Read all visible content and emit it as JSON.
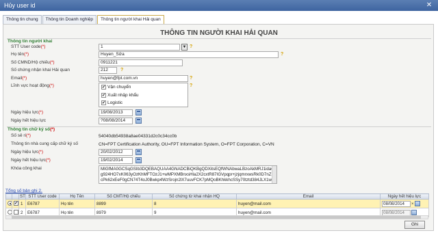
{
  "window": {
    "title": "Hủy user id",
    "close_glyph": "✕"
  },
  "tabs": [
    {
      "label": "Thông tin chung",
      "active": false
    },
    {
      "label": "Thông tin Doanh nghiệp",
      "active": false
    },
    {
      "label": "Thông tin người khai Hải quan",
      "active": true
    }
  ],
  "main_title": "THÔNG TIN NGƯỜI KHAI HẢI QUAN",
  "declarant": {
    "title": "Thông tin người khai",
    "stt_user_code": {
      "label": "STT User code",
      "value": "1"
    },
    "full_name": {
      "label": "Họ tên",
      "value": "Huyen_Sửa"
    },
    "id_number": {
      "label": "Số CMND/Hộ chiếu",
      "value": "0911221"
    },
    "customs_cert_number": {
      "label": "Số chứng nhận khai Hải quan",
      "value": "212"
    },
    "email": {
      "label": "Email",
      "value": "huyen@fpt.com.vn"
    },
    "fields_of_activity": {
      "label": "Lĩnh vực hoạt động",
      "options": [
        {
          "label": "Vận chuyển",
          "checked": true
        },
        {
          "label": "Xuất nhập khẩu",
          "checked": true
        },
        {
          "label": "Logistic",
          "checked": true
        }
      ]
    },
    "effective_date": {
      "label": "Ngày hiệu lực",
      "value": "19/08/2013"
    },
    "expiry_date": {
      "label": "Ngày hết hiệu lực",
      "value": "?08/08/2014"
    }
  },
  "digital_signature": {
    "title": "Thông tin chữ ký số",
    "serial": {
      "label": "Số sê ri",
      "value": "54040db54938a8ae04331d2c0c34cc0b"
    },
    "provider": {
      "label": "Thông tin nhà cung cấp chữ ký số",
      "value": "CN=FPT Certification Authority, OU=FPT Information System, O=FPT Corporation, C=VN"
    },
    "effective_date": {
      "label": "Ngày hiệu lực",
      "value": "20/02/2012"
    },
    "expiry_date": {
      "label": "Ngày hết hiệu lực",
      "value": "19/02/2014"
    },
    "public_key": {
      "label": "Khóa công khai",
      "value": "MIGfMA0GCSqGSIb3DQEBAQUAA4GNADCBiQKBgQDXitsEQfWNAbwaLBzoAkMRJ1idaGg924HO7xK063yOzKhMFTOzJ1+wMPXMBnxsHla2X2cxtR87IGVpqpr+jzjqmrxwsRk0D7nZBcPk62xEeF0gCN74T4oJ0Bwkp4WzSrojn2lX7uuvFCK7pMQoBKhkkhcSSy70tztd384JLX1wIDAQAB"
    }
  },
  "grid": {
    "totals_text": "Tổng số bản ghi 2.",
    "columns": [
      "",
      "",
      "STT",
      "STT User code",
      "Họ Tên",
      "Số CMT/Hộ chiếu",
      "Số chứng từ khai nhận HQ",
      "Email",
      "Ngày hết hiệu lực"
    ],
    "rows": [
      {
        "selected": true,
        "checked": true,
        "stt": "1",
        "user_code": "E6787",
        "name": "Họ tên",
        "id_no": "8899",
        "doc_no": "8",
        "email": "huyen@mail.com",
        "expiry": "08/08/2014",
        "editable": true
      },
      {
        "selected": false,
        "checked": false,
        "stt": "2",
        "user_code": "E6787",
        "name": "Họ tên",
        "id_no": "8979",
        "doc_no": "9",
        "email": "huyen@mail.com",
        "expiry": "08/08/2014",
        "editable": false
      }
    ]
  },
  "buttons": {
    "save_label": "Ghi"
  },
  "glyphs": {
    "help": "?",
    "required": "(*)",
    "check": "✔",
    "dropdown": "▼",
    "clear": "×"
  },
  "colors": {
    "titlebar": "#3e64a0",
    "section_title": "#2e7d32",
    "required": "#cc0000",
    "selected_row": "#fff2b3"
  }
}
